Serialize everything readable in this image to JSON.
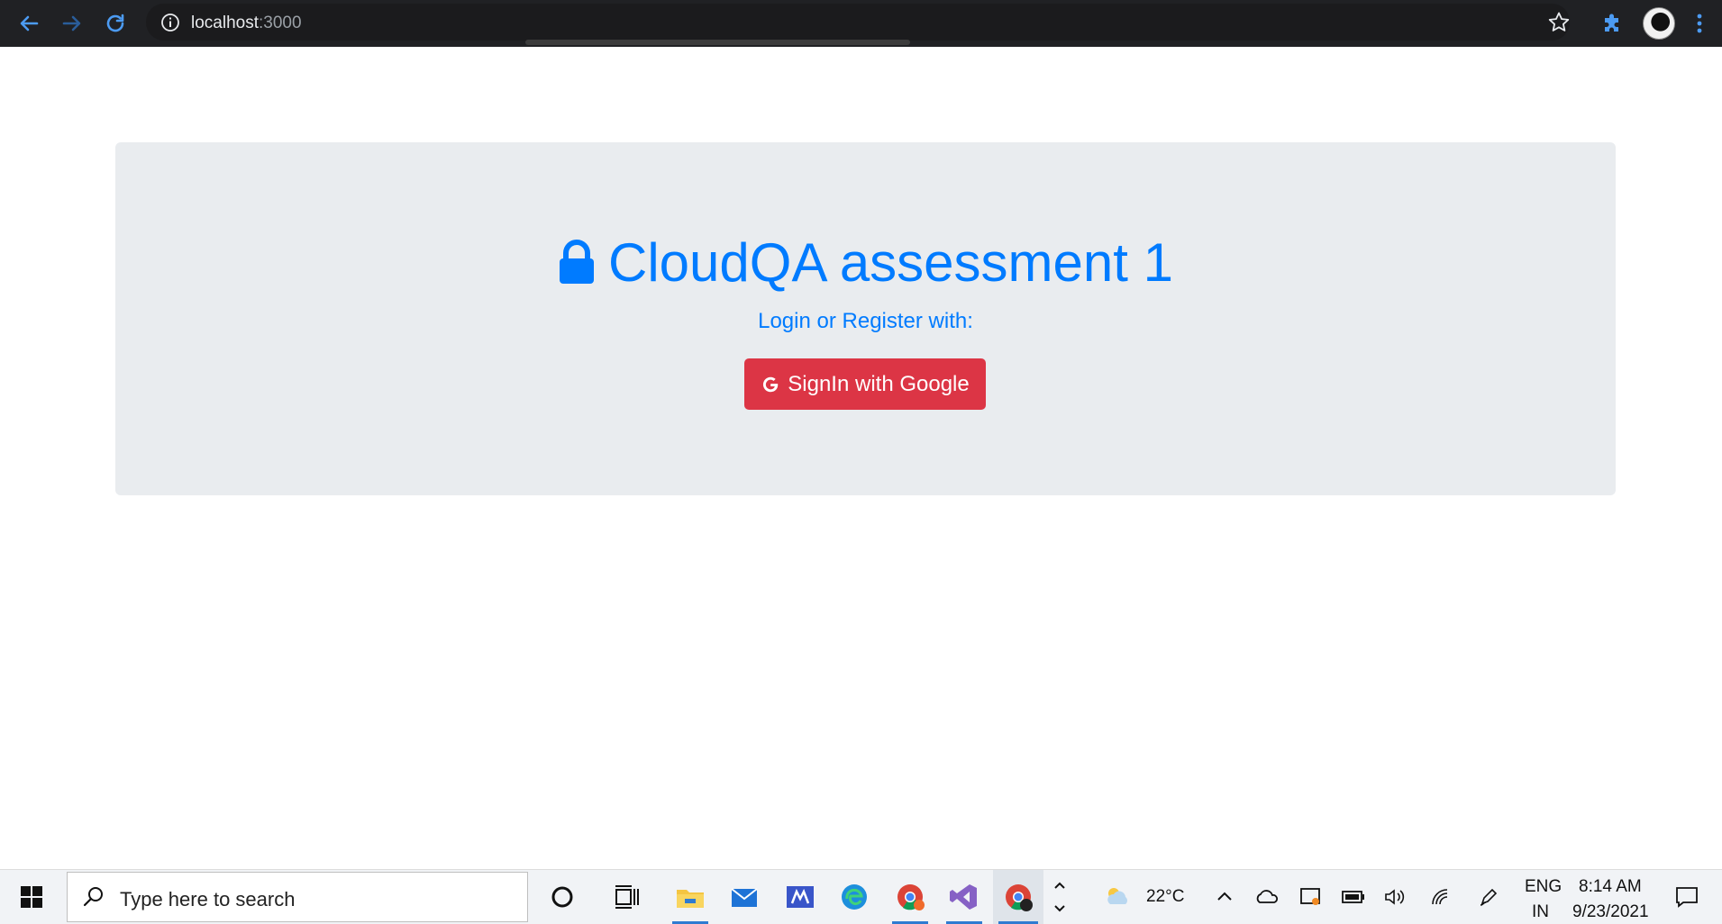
{
  "browser": {
    "url_host": "localhost",
    "url_port": ":3000"
  },
  "page": {
    "title": "CloudQA assessment 1",
    "subtitle": "Login or Register with:",
    "google_button_label": "SignIn with Google"
  },
  "colors": {
    "primary": "#007bff",
    "danger": "#dc3545",
    "jumbotron_bg": "#e9ecef"
  },
  "taskbar": {
    "search_placeholder": "Type here to search",
    "weather_temp": "22°C",
    "language_line1": "ENG",
    "language_line2": "IN",
    "time": "8:14 AM",
    "date": "9/23/2021"
  }
}
